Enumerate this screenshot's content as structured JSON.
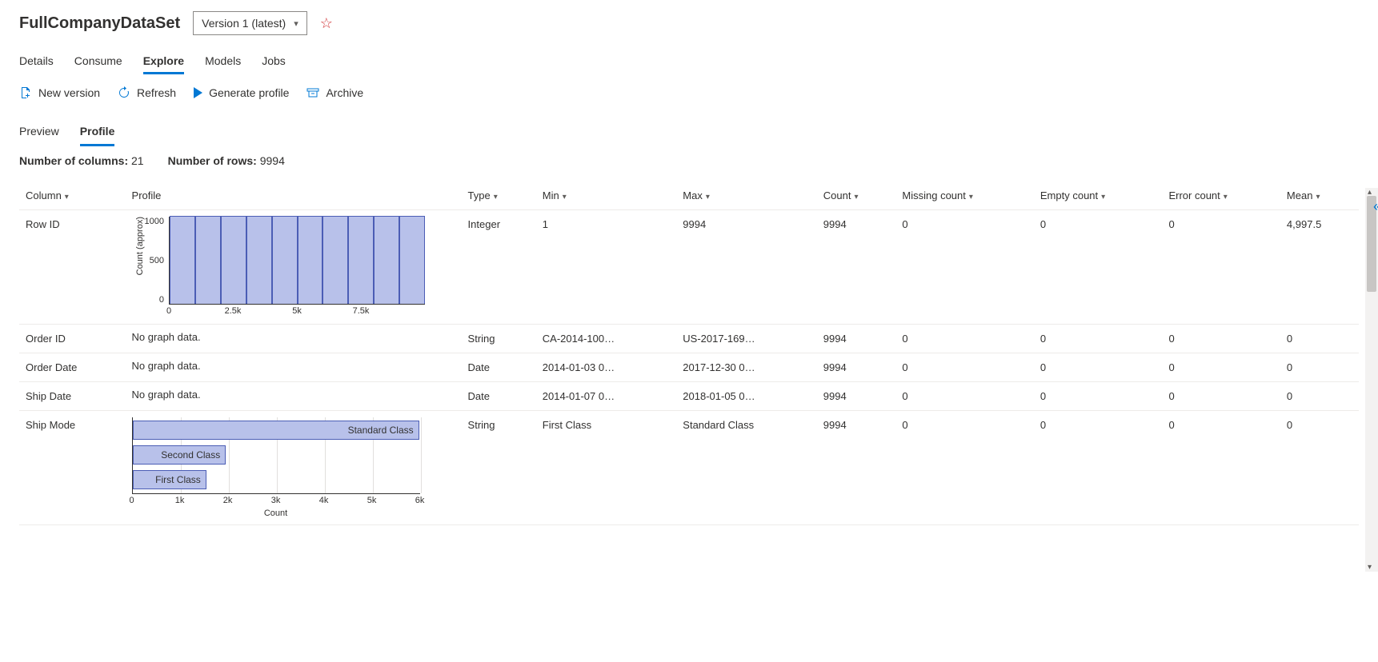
{
  "header": {
    "title": "FullCompanyDataSet",
    "version_label": "Version 1 (latest)"
  },
  "tabs": [
    "Details",
    "Consume",
    "Explore",
    "Models",
    "Jobs"
  ],
  "active_tab": "Explore",
  "toolbar": {
    "new_version": "New version",
    "refresh": "Refresh",
    "generate_profile": "Generate profile",
    "archive": "Archive"
  },
  "subtabs": [
    "Preview",
    "Profile"
  ],
  "active_subtab": "Profile",
  "stats": {
    "cols_label": "Number of columns:",
    "cols_value": "21",
    "rows_label": "Number of rows:",
    "rows_value": "9994"
  },
  "table": {
    "headers": [
      "Column",
      "Profile",
      "Type",
      "Min",
      "Max",
      "Count",
      "Missing count",
      "Empty count",
      "Error count",
      "Mean"
    ],
    "rows": [
      {
        "column": "Row ID",
        "profile_kind": "hist",
        "type": "Integer",
        "min": "1",
        "max": "9994",
        "count": "9994",
        "missing": "0",
        "empty": "0",
        "error": "0",
        "mean": "4,997.5"
      },
      {
        "column": "Order ID",
        "profile_kind": "none",
        "profile_text": "No graph data.",
        "type": "String",
        "min": "CA-2014-100…",
        "max": "US-2017-169…",
        "count": "9994",
        "missing": "0",
        "empty": "0",
        "error": "0",
        "mean": "0"
      },
      {
        "column": "Order Date",
        "profile_kind": "none",
        "profile_text": "No graph data.",
        "type": "Date",
        "min": "2014-01-03 0…",
        "max": "2017-12-30 0…",
        "count": "9994",
        "missing": "0",
        "empty": "0",
        "error": "0",
        "mean": "0"
      },
      {
        "column": "Ship Date",
        "profile_kind": "none",
        "profile_text": "No graph data.",
        "type": "Date",
        "min": "2014-01-07 0…",
        "max": "2018-01-05 0…",
        "count": "9994",
        "missing": "0",
        "empty": "0",
        "error": "0",
        "mean": "0"
      },
      {
        "column": "Ship Mode",
        "profile_kind": "hbar",
        "type": "String",
        "min": "First Class",
        "max": "Standard Class",
        "count": "9994",
        "missing": "0",
        "empty": "0",
        "error": "0",
        "mean": "0"
      }
    ]
  },
  "chart_data": [
    {
      "id": "row_id_hist",
      "type": "bar",
      "title": "",
      "ylabel": "Count (approx)",
      "xlabel": "",
      "categories": [
        500,
        1500,
        2500,
        3500,
        4500,
        5500,
        6500,
        7500,
        8500,
        9500
      ],
      "values": [
        1000,
        1000,
        1000,
        1000,
        1000,
        1000,
        1000,
        1000,
        1000,
        1000
      ],
      "yticks": [
        0,
        500,
        1000
      ],
      "xticks": [
        0,
        2500,
        5000,
        7500
      ],
      "xtick_labels": [
        "0",
        "2.5k",
        "5k",
        "7.5k"
      ],
      "ylim": [
        0,
        1000
      ],
      "xlim": [
        0,
        10000
      ]
    },
    {
      "id": "ship_mode_hbar",
      "type": "bar",
      "orientation": "horizontal",
      "xlabel": "Count",
      "categories": [
        "Standard Class",
        "Second Class",
        "First Class"
      ],
      "values": [
        5968,
        1945,
        1538
      ],
      "xticks": [
        0,
        1000,
        2000,
        3000,
        4000,
        5000,
        6000
      ],
      "xtick_labels": [
        "0",
        "1k",
        "2k",
        "3k",
        "4k",
        "5k",
        "6k"
      ],
      "xlim": [
        0,
        6000
      ]
    }
  ]
}
